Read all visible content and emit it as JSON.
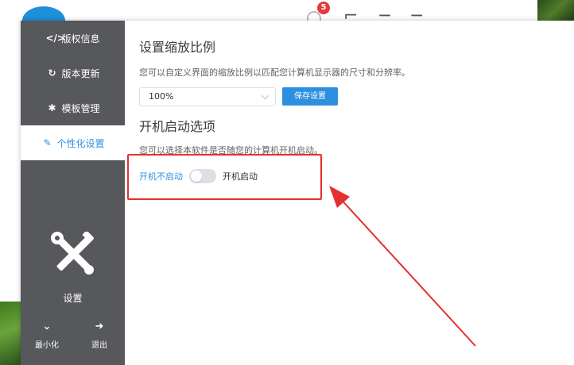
{
  "background": {
    "notification_count": "5"
  },
  "sidebar": {
    "items": [
      {
        "label": "版权信息",
        "icon": "code-icon",
        "glyph": "</>"
      },
      {
        "label": "版本更新",
        "icon": "refresh-icon",
        "glyph": "↻"
      },
      {
        "label": "模板管理",
        "icon": "gear-icon",
        "glyph": "✱"
      },
      {
        "label": "个性化设置",
        "icon": "wrench-icon",
        "glyph": "✎",
        "active": true
      }
    ],
    "settings_label": "设置",
    "minimize": {
      "label": "最小化",
      "glyph": "⌄",
      "icon": "double-chevron-down-icon"
    },
    "exit": {
      "label": "退出",
      "glyph": "➜",
      "icon": "sign-out-icon"
    }
  },
  "scale_section": {
    "title": "设置缩放比例",
    "description": "您可以自定义界面的缩放比例以匹配您计算机显示器的尺寸和分辨率。",
    "selected_value": "100%",
    "save_label": "保存设置"
  },
  "startup_section": {
    "title": "开机启动选项",
    "description": "您可以选择本软件是否随您的计算机开机启动。",
    "option_off": "开机不启动",
    "option_on": "开机启动",
    "enabled": false
  },
  "colors": {
    "accent": "#2d8fe0",
    "sidebar": "#57585c",
    "annotation": "#e62f2f"
  }
}
